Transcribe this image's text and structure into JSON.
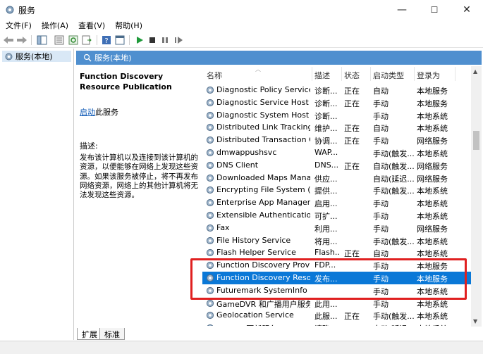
{
  "window": {
    "title": "服务",
    "minimize": "—",
    "maximize": "☐",
    "close": "✕"
  },
  "menu": [
    "文件(F)",
    "操作(A)",
    "查看(V)",
    "帮助(H)"
  ],
  "tree": {
    "root_label": "服务(本地)"
  },
  "panel": {
    "header": "服务(本地)",
    "service_title": "Function Discovery Resource Publication",
    "start_link": "启动",
    "start_suffix": "此服务",
    "desc_label": "描述:",
    "desc_text": "发布该计算机以及连接到该计算机的资源，以便能够在网络上发现这些资源。如果该服务被停止，将不再发布网络资源，网络上的其他计算机将无法发现这些资源。"
  },
  "columns": [
    "名称",
    "描述",
    "状态",
    "启动类型",
    "登录为"
  ],
  "services": [
    {
      "name": "Diagnostic Policy Service",
      "desc": "诊断...",
      "status": "正在",
      "start": "自动",
      "logon": "本地服务"
    },
    {
      "name": "Diagnostic Service Host",
      "desc": "诊断...",
      "status": "正在",
      "start": "手动",
      "logon": "本地服务"
    },
    {
      "name": "Diagnostic System Host",
      "desc": "诊断...",
      "status": "",
      "start": "手动",
      "logon": "本地系统"
    },
    {
      "name": "Distributed Link Tracking C...",
      "desc": "维护...",
      "status": "正在",
      "start": "自动",
      "logon": "本地系统"
    },
    {
      "name": "Distributed Transaction Co...",
      "desc": "协调...",
      "status": "正在",
      "start": "手动",
      "logon": "网络服务"
    },
    {
      "name": "dmwappushsvc",
      "desc": "WAP...",
      "status": "",
      "start": "手动(触发...",
      "logon": "本地系统"
    },
    {
      "name": "DNS Client",
      "desc": "DNS...",
      "status": "正在",
      "start": "自动(触发...",
      "logon": "网络服务"
    },
    {
      "name": "Downloaded Maps Manager",
      "desc": "供应...",
      "status": "",
      "start": "自动(延迟...",
      "logon": "网络服务"
    },
    {
      "name": "Encrypting File System (EFS)",
      "desc": "提供...",
      "status": "",
      "start": "手动(触发...",
      "logon": "本地系统"
    },
    {
      "name": "Enterprise App Manageme...",
      "desc": "启用...",
      "status": "",
      "start": "手动",
      "logon": "本地系统"
    },
    {
      "name": "Extensible Authentication ...",
      "desc": "可扩...",
      "status": "",
      "start": "手动",
      "logon": "本地系统"
    },
    {
      "name": "Fax",
      "desc": "利用...",
      "status": "",
      "start": "手动",
      "logon": "网络服务"
    },
    {
      "name": "File History Service",
      "desc": "将用...",
      "status": "",
      "start": "手动(触发...",
      "logon": "本地系统"
    },
    {
      "name": "Flash Helper Service",
      "desc": "Flash...",
      "status": "正在",
      "start": "自动",
      "logon": "本地系统"
    },
    {
      "name": "Function Discovery Provide...",
      "desc": "FDP...",
      "status": "",
      "start": "手动",
      "logon": "本地服务"
    },
    {
      "name": "Function Discovery Resour...",
      "desc": "发布...",
      "status": "",
      "start": "手动",
      "logon": "本地服务"
    },
    {
      "name": "Futuremark SystemInfo Ser...",
      "desc": "",
      "status": "",
      "start": "手动",
      "logon": "本地系统"
    },
    {
      "name": "GameDVR 和广播用户服务...",
      "desc": "此用...",
      "status": "",
      "start": "手动",
      "logon": "本地系统"
    },
    {
      "name": "Geolocation Service",
      "desc": "此服...",
      "status": "正在",
      "start": "手动(触发...",
      "logon": "本地系统"
    },
    {
      "name": "Google 更新服务 (gupdate)",
      "desc": "请确...",
      "status": "",
      "start": "自动(延迟...",
      "logon": "本地系统"
    }
  ],
  "selected_index": 15,
  "tabs": [
    "扩展",
    "标准"
  ],
  "colors": {
    "selection": "#0a78d7",
    "header": "#4f8fcf",
    "highlight_box": "#e02020",
    "link": "#0b57b5"
  }
}
